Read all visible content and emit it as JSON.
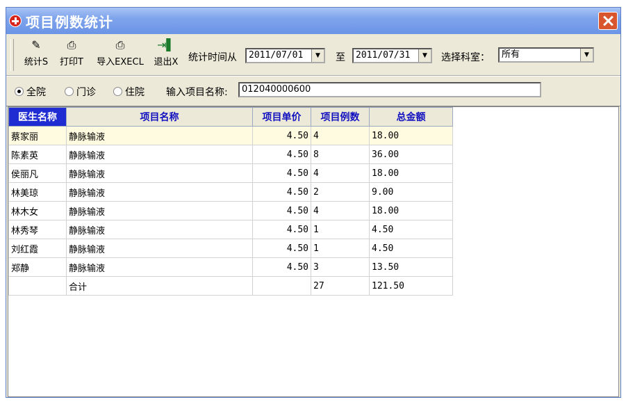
{
  "window": {
    "title": "项目例数统计"
  },
  "toolbar": {
    "buttons": [
      {
        "label": "统计S",
        "icon": "edit-icon"
      },
      {
        "label": "打印T",
        "icon": "printer-icon"
      },
      {
        "label": "导入EXECL",
        "icon": "printer-icon"
      },
      {
        "label": "退出X",
        "icon": "exit-door-icon"
      }
    ],
    "time_from_label": "统计时间从",
    "date_from": "2011/07/01",
    "to_label": "至",
    "date_to": "2011/07/31",
    "dept_label": "选择科室：",
    "dept_value": "所有"
  },
  "filter": {
    "radios": [
      "全院",
      "门诊",
      "住院"
    ],
    "selected": 0,
    "item_name_label": "输入项目名称:",
    "item_name_value": "012040000600"
  },
  "table": {
    "columns": [
      "医生名称",
      "项目名称",
      "项目单价",
      "项目例数",
      "总金额"
    ],
    "rows": [
      [
        "蔡家丽",
        "静脉输液",
        "4.50",
        "4",
        "18.00"
      ],
      [
        "陈素英",
        "静脉输液",
        "4.50",
        "8",
        "36.00"
      ],
      [
        "侯丽凡",
        "静脉输液",
        "4.50",
        "4",
        "18.00"
      ],
      [
        "林美琼",
        "静脉输液",
        "4.50",
        "2",
        "9.00"
      ],
      [
        "林木女",
        "静脉输液",
        "4.50",
        "4",
        "18.00"
      ],
      [
        "林秀琴",
        "静脉输液",
        "4.50",
        "1",
        "4.50"
      ],
      [
        "刘红霞",
        "静脉输液",
        "4.50",
        "1",
        "4.50"
      ],
      [
        "郑静",
        "静脉输液",
        "4.50",
        "3",
        "13.50"
      ]
    ],
    "total_row": [
      "",
      "合计",
      "",
      "27",
      "121.50"
    ]
  }
}
